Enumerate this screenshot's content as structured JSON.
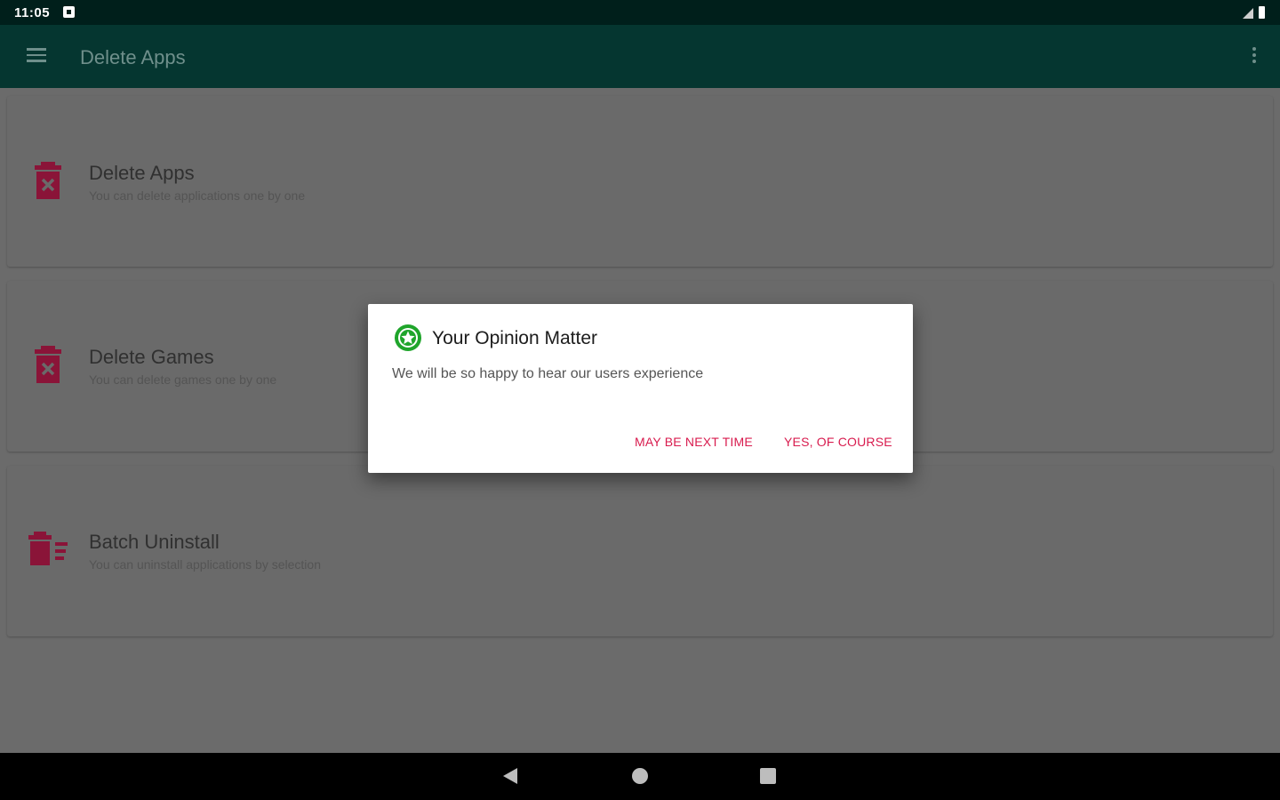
{
  "status_bar": {
    "time": "11:05"
  },
  "app_bar": {
    "title": "Delete Apps"
  },
  "cards": [
    {
      "title": "Delete Apps",
      "subtitle": "You can delete applications one by one",
      "icon": "trash-x-icon"
    },
    {
      "title": "Delete Games",
      "subtitle": "You can delete games one by one",
      "icon": "trash-x-icon"
    },
    {
      "title": "Batch Uninstall",
      "subtitle": "You can uninstall applications by selection",
      "icon": "batch-delete-icon"
    }
  ],
  "dialog": {
    "title": "Your Opinion Matter",
    "message": "We will be so happy to hear our users experience",
    "negative_button": "MAY BE NEXT TIME",
    "positive_button": "YES, OF COURSE",
    "icon": "star-badge-icon"
  },
  "colors": {
    "status_bar": "#001f1b",
    "app_bar": "#053630",
    "accent": "#d81b4e",
    "icon_red": "#8a1438",
    "star_green": "#1fa52b"
  }
}
